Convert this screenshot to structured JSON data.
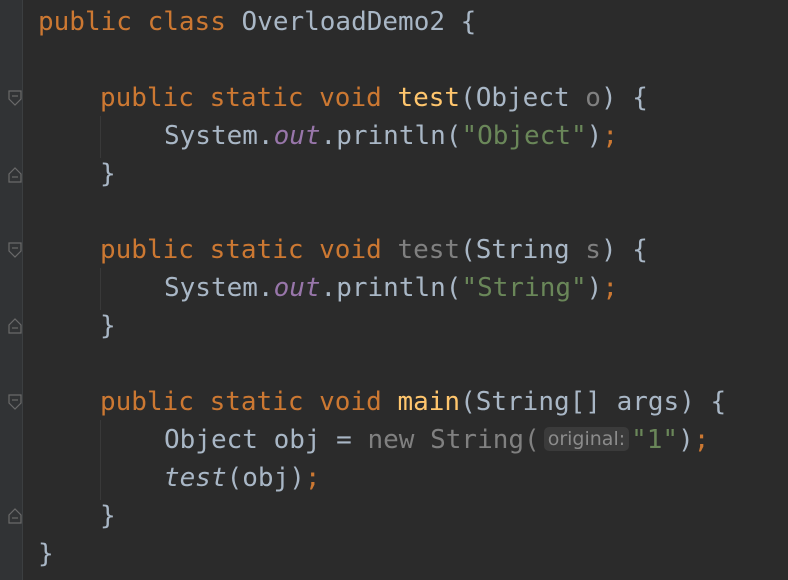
{
  "editor": {
    "colors": {
      "background": "#2b2b2b",
      "keyword": "#cc7832",
      "method_declaration": "#ffc66d",
      "unused": "#808080",
      "static_field": "#9876aa",
      "string": "#6a8759",
      "default_text": "#a9b7c6",
      "hint_background": "#3b3b3b",
      "hint_text": "#8c8c8c"
    },
    "lines": {
      "l1": {
        "kw1": "public",
        "kw2": "class",
        "name": "OverloadDemo2",
        "brace": "{"
      },
      "l3": {
        "kw1": "public",
        "kw2": "static",
        "kw3": "void",
        "method": "test",
        "open": "(",
        "type": "Object",
        "param": "o",
        "close": ")",
        "brace": "{"
      },
      "l4": {
        "sys": "System",
        "dot1": ".",
        "out": "out",
        "dot2": ".println(",
        "str": "\"Object\"",
        "close": ")",
        "semi": ";"
      },
      "l5": {
        "brace": "}"
      },
      "l7": {
        "kw1": "public",
        "kw2": "static",
        "kw3": "void",
        "method": "test",
        "open": "(",
        "type": "String",
        "param": "s",
        "close": ")",
        "brace": "{"
      },
      "l8": {
        "sys": "System",
        "dot1": ".",
        "out": "out",
        "dot2": ".println(",
        "str": "\"String\"",
        "close": ")",
        "semi": ";"
      },
      "l9": {
        "brace": "}"
      },
      "l11": {
        "kw1": "public",
        "kw2": "static",
        "kw3": "void",
        "method": "main",
        "params": "(String[] args)",
        "brace": "{"
      },
      "l12": {
        "decl": "Object obj = ",
        "kw_new": "new",
        "ctor": "String(",
        "hint": "original:",
        "str": "\"1\"",
        "close": ")",
        "semi": ";"
      },
      "l13": {
        "call": "test",
        "args": "(obj)",
        "semi": ";"
      },
      "l14": {
        "brace": "}"
      },
      "l15": {
        "brace": "}"
      }
    }
  }
}
